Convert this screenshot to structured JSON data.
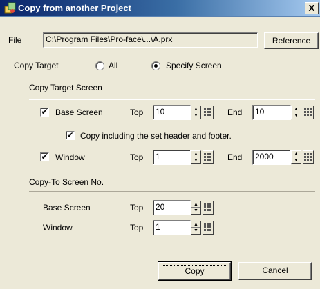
{
  "window": {
    "title": "Copy from another Project",
    "close_symbol": "X",
    "title_icon": "project-copy-icon"
  },
  "file": {
    "label": "File",
    "path": "C:\\Program Files\\Pro-face\\...\\A.prx",
    "reference_button": "Reference"
  },
  "copy_target": {
    "label": "Copy Target",
    "options": [
      {
        "label": "All",
        "selected": false
      },
      {
        "label": "Specify Screen",
        "selected": true
      }
    ]
  },
  "copy_target_screen": {
    "heading": "Copy Target Screen",
    "base_screen": {
      "checked": true,
      "label": "Base Screen",
      "top_label": "Top",
      "top_value": "10",
      "end_label": "End",
      "end_value": "10"
    },
    "include_header_footer": {
      "checked": true,
      "label": "Copy including the set header and footer."
    },
    "window": {
      "checked": true,
      "label": "Window",
      "top_label": "Top",
      "top_value": "1",
      "end_label": "End",
      "end_value": "2000"
    }
  },
  "copy_to": {
    "heading": "Copy-To Screen No.",
    "base_screen": {
      "label": "Base Screen",
      "top_label": "Top",
      "top_value": "20"
    },
    "window": {
      "label": "Window",
      "top_label": "Top",
      "top_value": "1"
    }
  },
  "buttons": {
    "copy": "Copy",
    "cancel": "Cancel"
  },
  "symbols": {
    "check": "✔",
    "spin_up": "▲",
    "spin_down": "▼"
  },
  "colors": {
    "dialog_bg": "#ece9d8",
    "title_start": "#0a246a",
    "title_end": "#a6caf0"
  }
}
